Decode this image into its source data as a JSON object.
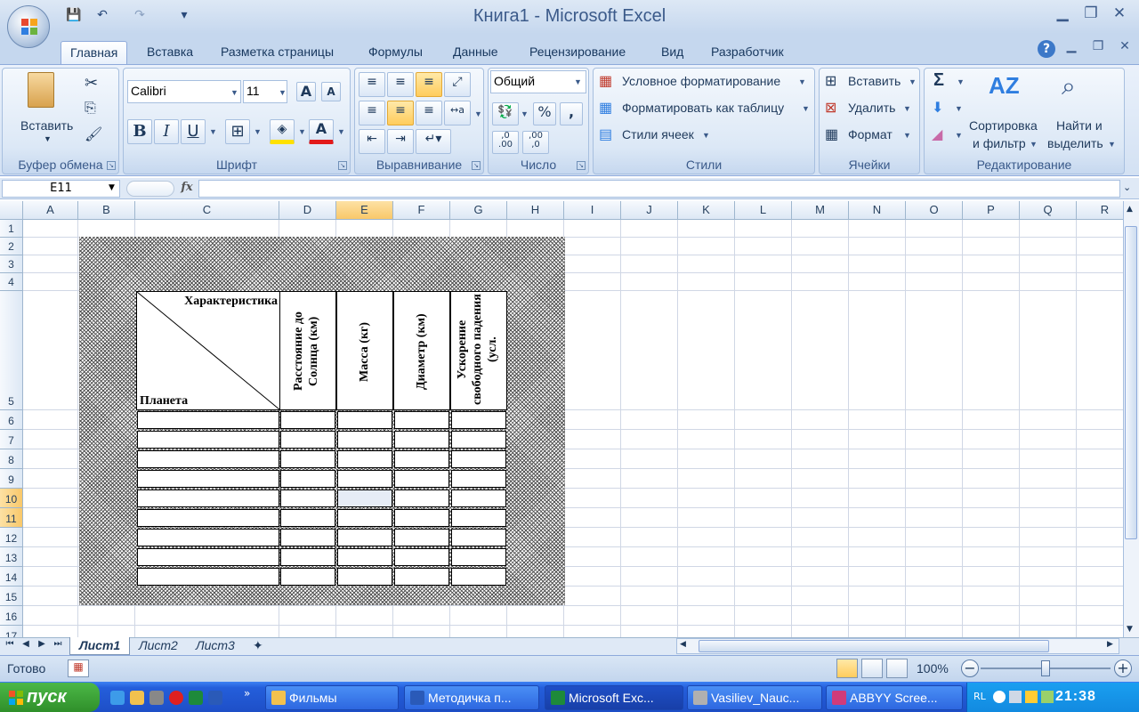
{
  "window": {
    "title": "Книга1 - Microsoft Excel"
  },
  "tabs": [
    "Главная",
    "Вставка",
    "Разметка страницы",
    "Формулы",
    "Данные",
    "Рецензирование",
    "Вид",
    "Разработчик"
  ],
  "ribbon": {
    "clipboard": {
      "label": "Буфер обмена",
      "paste": "Вставить"
    },
    "font": {
      "label": "Шрифт",
      "name": "Calibri",
      "size": "11",
      "bold": "B",
      "italic": "I",
      "underline": "U"
    },
    "alignment": {
      "label": "Выравнивание"
    },
    "number": {
      "label": "Число",
      "format": "Общий",
      "percent": "%",
      "comma": ",",
      "inc": ",0\n.00",
      "dec": ",00\n,0"
    },
    "styles": {
      "label": "Стили",
      "cond": "Условное форматирование",
      "astable": "Форматировать как таблицу",
      "cellstyles": "Стили ячеек"
    },
    "cells": {
      "label": "Ячейки",
      "insert": "Вставить",
      "delete": "Удалить",
      "format": "Формат"
    },
    "editing": {
      "label": "Редактирование",
      "sort1": "Сортировка",
      "sort2": "и фильтр",
      "find1": "Найти и",
      "find2": "выделить",
      "sigma": "Σ"
    }
  },
  "formula_bar": {
    "name_box": "E11",
    "fx": "fx",
    "value": ""
  },
  "grid": {
    "columns": [
      "A",
      "B",
      "C",
      "D",
      "E",
      "F",
      "G",
      "H",
      "I",
      "J",
      "K",
      "L",
      "M",
      "N",
      "O",
      "P",
      "Q",
      "R"
    ],
    "rows": [
      "1",
      "2",
      "3",
      "4",
      "5",
      "6",
      "7",
      "8",
      "9",
      "10",
      "11",
      "12",
      "13",
      "14",
      "15",
      "16",
      "17"
    ],
    "selected_column": "E",
    "selected_rows": [
      "10",
      "11"
    ]
  },
  "table": {
    "corner_top": "Характеристика",
    "corner_bottom": "Планета",
    "headers": [
      "Расстояние до Солнца (км)",
      "Масса (кг)",
      "Диаметр (км)",
      "Ускорение свободного падения (усл."
    ]
  },
  "sheets": [
    "Лист1",
    "Лист2",
    "Лист3"
  ],
  "status": {
    "text": "Готово",
    "zoom": "100%"
  },
  "taskbar": {
    "start": "пуск",
    "items": [
      "Фильмы",
      "Методичка п...",
      "Microsoft Exc...",
      "Vasiliev_Nauc...",
      "ABBYY Scree..."
    ],
    "tray_lang": "RL",
    "clock": "21:38"
  }
}
